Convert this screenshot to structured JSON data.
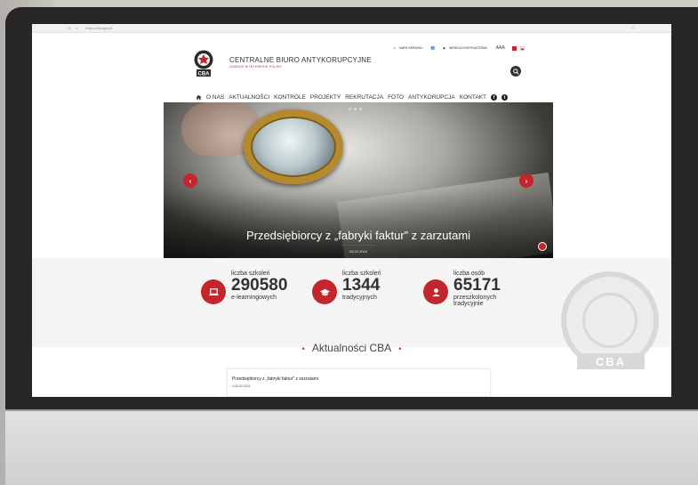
{
  "browser": {
    "url": "https://cba.gov.pl"
  },
  "site": {
    "title": "CENTRALNE BIURO ANTYKORUPCYJNE",
    "subtitle": "ZAWSZE W INTERESIE POLSKI",
    "logo_text": "CBA"
  },
  "utility": {
    "sitemap": "MAPA SERWISU",
    "contrast": "WERSJA KONTRASTOWA",
    "font_size": "AAA"
  },
  "nav": {
    "items": [
      "O NAS",
      "AKTUALNOŚCI",
      "KONTROLE",
      "PROJEKTY",
      "REKRUTACJA",
      "FOTO",
      "ANTYKORUPCJA",
      "KONTAKT"
    ]
  },
  "hero": {
    "caption": "Przedsiębiorcy z „fabryki faktur” z zarzutami",
    "date": "26.02.2024",
    "prev": "‹",
    "next": "›"
  },
  "stats": [
    {
      "label": "liczba szkoleń",
      "value": "290580",
      "suffix": "e-learningowych"
    },
    {
      "label": "liczba szkoleń",
      "value": "1344",
      "suffix": "tradycyjnych"
    },
    {
      "label": "liczba osób",
      "value": "65171",
      "suffix": "przeszkolonych",
      "suffix2": "tradycyjnie"
    }
  ],
  "seal": {
    "text": "CBA"
  },
  "news": {
    "heading": "Aktualności CBA",
    "dot": "•",
    "card_title": "Przedsiębiorcy z „fabryki faktur” z zarzutami",
    "card_date": "26.02.2024"
  },
  "colors": {
    "accent": "#c4262e"
  }
}
